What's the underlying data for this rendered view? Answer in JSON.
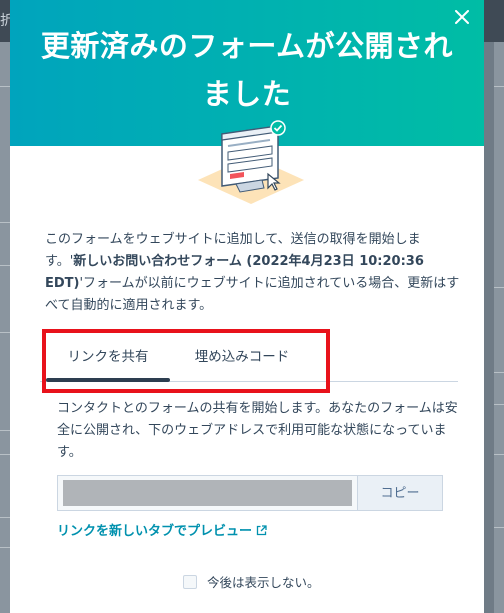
{
  "background": {
    "corner_text": "折"
  },
  "modal": {
    "title": "更新済みのフォームが公開されました",
    "close_icon": "close-icon",
    "description": {
      "part1": "このフォームをウェブサイトに追加して、送信の取得を開始します。'",
      "form_name": "新しいお問い合わせフォーム (2022年4月23日 10:20:36 EDT)",
      "part2": "'フォームが以前にウェブサイトに追加されている場合、更新はすべて自動的に適用されます。"
    },
    "tabs": [
      {
        "label": "リンクを共有",
        "active": true
      },
      {
        "label": "埋め込みコード",
        "active": false
      }
    ],
    "share_text": "コンタクトとのフォームの共有を開始します。あなたのフォームは安全に公開され、下のウェブアドレスで利用可能な状態になっています。",
    "url_value": "",
    "copy_label": "コピー",
    "preview_link": "リンクを新しいタブでプレビュー",
    "dont_show_label": "今後は表示しない。"
  },
  "colors": {
    "header_gradient_start": "#00a4bd",
    "header_gradient_end": "#00bda5",
    "highlight": "#e8121b",
    "link": "#0091ae",
    "text": "#33475b"
  }
}
